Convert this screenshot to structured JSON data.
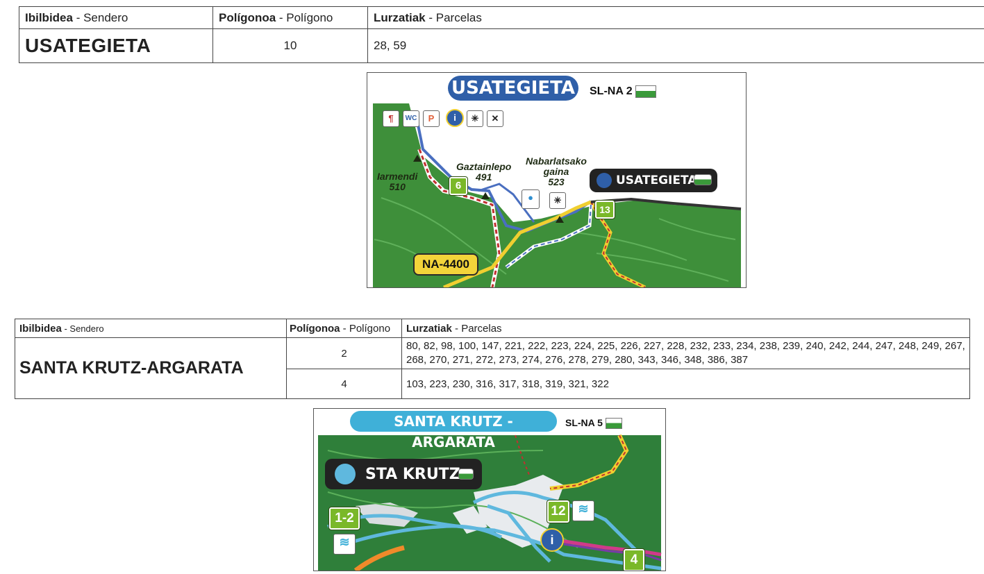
{
  "table1": {
    "headers": [
      {
        "bold": "Ibilbidea",
        "rest": " - Sendero"
      },
      {
        "bold": "Polígonoa",
        "rest": " - Polígono"
      },
      {
        "bold": "Lurzatiak",
        "rest": " - Parcelas"
      }
    ],
    "route": "USATEGIETA",
    "poligono": "10",
    "parcelas": "28, 59"
  },
  "map1": {
    "title": "USATEGIETA",
    "code": "SL-NA 2",
    "labels": {
      "iarmendi": "Iarmendi",
      "iarmendi_alt": "510",
      "gaztainlepo": "Gaztainlepo",
      "gaztainlepo_alt": "491",
      "nabarlatsako": "Nabarlatsako",
      "nabarlatsako2": "gaina",
      "nabarlatsako_alt": "523"
    },
    "callout": "USATEGIETA",
    "numbers": [
      "6",
      "13"
    ],
    "road": "NA-4400",
    "icons": [
      "restaurant-icon",
      "wc-icon",
      "parking-icon",
      "info-icon",
      "viewpoint-icon",
      "bird-icon",
      "water-icon"
    ],
    "colors": {
      "title_pill": "#2f5fa8",
      "forest": "#3e8f3a",
      "track_blue": "#4a6fc0",
      "road_yellow": "#f0cf30"
    }
  },
  "table2": {
    "headers": [
      {
        "bold": "Ibilbidea",
        "rest": " - Sendero"
      },
      {
        "bold": "Polígonoa",
        "rest": " - Polígono"
      },
      {
        "bold": "Lurzatiak",
        "rest": " - Parcelas"
      }
    ],
    "route": "SANTA KRUTZ-ARGARATA",
    "rows": [
      {
        "poligono": "2",
        "parcelas": "80, 82, 98, 100, 147, 221, 222, 223, 224, 225, 226, 227, 228, 232, 233, 234, 238, 239, 240, 242, 244, 247, 248, 249, 267, 268, 270, 271, 272, 273, 274, 276, 278, 279, 280, 343, 346, 348, 386, 387"
      },
      {
        "poligono": "4",
        "parcelas": "103, 223, 230, 316, 317, 318, 319, 321, 322"
      }
    ]
  },
  "map2": {
    "title": "SANTA KRUTZ - ARGARATA",
    "code": "SL-NA 5",
    "callout": "STA KRUTZ",
    "numbers": [
      "1-2",
      "12",
      "4"
    ],
    "icons": [
      "water-waves-icon",
      "info-icon"
    ],
    "colors": {
      "title_pill": "#3fb0d8",
      "forest": "#2f7f3a",
      "track": "#5fb8de"
    }
  }
}
